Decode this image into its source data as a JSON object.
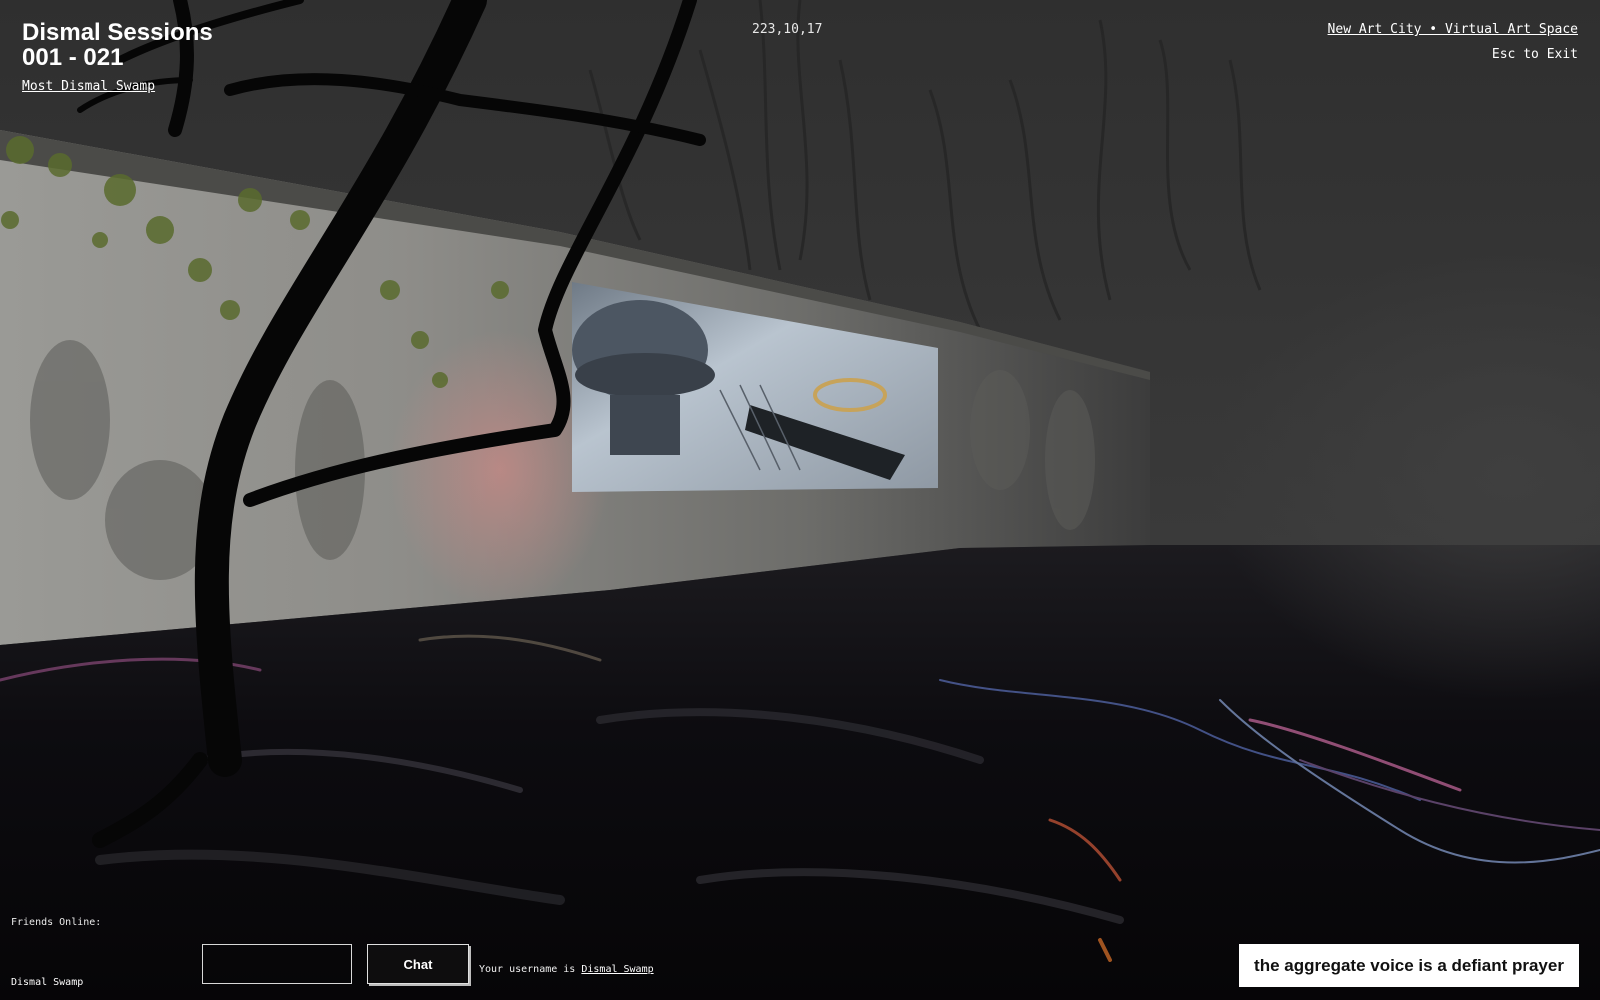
{
  "header": {
    "title_line1": "Dismal Sessions",
    "title_line2": "001 - 021",
    "space_link": "Most Dismal Swamp",
    "coordinates": "223,10,17"
  },
  "top_right": {
    "site_link": "New Art City • Virtual Art Space",
    "exit_hint": "Esc to Exit"
  },
  "friends": {
    "label": "Friends Online:",
    "names": [
      "Dismal Swamp"
    ]
  },
  "chat": {
    "input_value": "",
    "button_label": "Chat",
    "username_prefix": "Your username is ",
    "username": "Dismal Swamp"
  },
  "caption": {
    "text": "the aggregate voice is a defiant prayer"
  },
  "colors": {
    "background": "#2e2e2e",
    "wall": "#8a8a86",
    "floor": "#0c0b0e",
    "caption_bg": "#ffffff"
  }
}
